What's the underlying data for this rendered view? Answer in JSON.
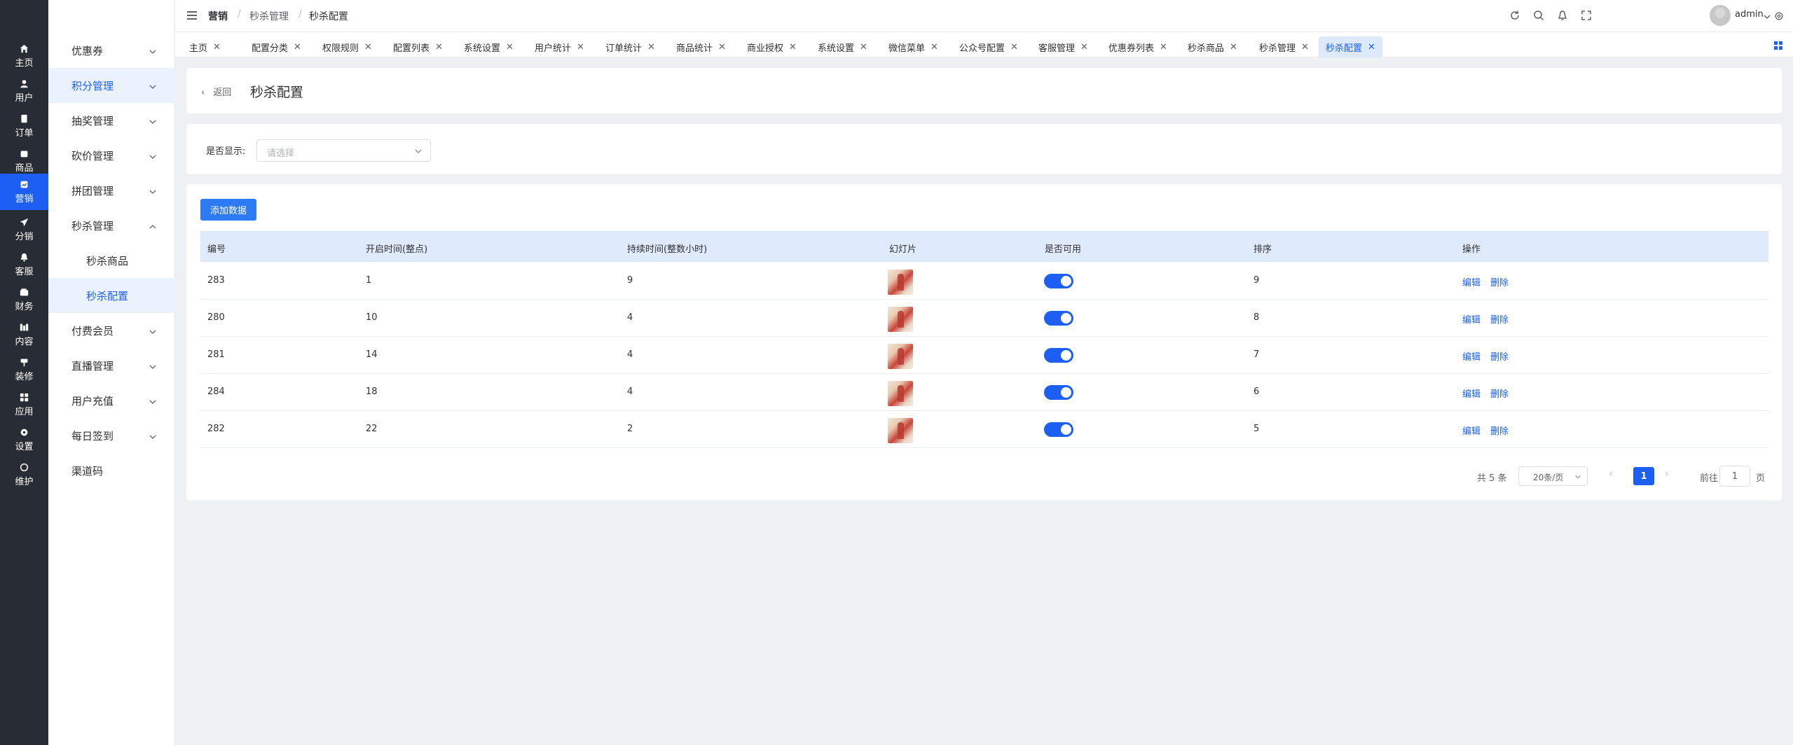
{
  "rail": [
    {
      "label": "主页",
      "icon": "home-icon"
    },
    {
      "label": "用户",
      "icon": "user-icon"
    },
    {
      "label": "订单",
      "icon": "order-icon"
    },
    {
      "label": "商品",
      "icon": "goods-icon"
    },
    {
      "label": "营销",
      "icon": "marketing-icon",
      "active": true
    },
    {
      "label": "分销",
      "icon": "send-icon"
    },
    {
      "label": "客服",
      "icon": "bell-icon"
    },
    {
      "label": "财务",
      "icon": "wallet-icon"
    },
    {
      "label": "内容",
      "icon": "content-icon"
    },
    {
      "label": "装修",
      "icon": "brush-icon"
    },
    {
      "label": "应用",
      "icon": "apps-icon"
    },
    {
      "label": "设置",
      "icon": "gear-icon"
    },
    {
      "label": "维护",
      "icon": "maintain-icon"
    }
  ],
  "menu": {
    "items": [
      {
        "label": "优惠券",
        "chevron": "down"
      },
      {
        "label": "积分管理",
        "chevron": "down",
        "active": true
      },
      {
        "label": "抽奖管理",
        "chevron": "down"
      },
      {
        "label": "砍价管理",
        "chevron": "down"
      },
      {
        "label": "拼团管理",
        "chevron": "down"
      },
      {
        "label": "秒杀管理",
        "chevron": "up"
      },
      {
        "label": "秒杀商品",
        "sub": true
      },
      {
        "label": "秒杀配置",
        "sub": true,
        "active": true
      },
      {
        "label": "付费会员",
        "chevron": "down"
      },
      {
        "label": "直播管理",
        "chevron": "down"
      },
      {
        "label": "用户充值",
        "chevron": "down"
      },
      {
        "label": "每日签到",
        "chevron": "down"
      },
      {
        "label": "渠道码"
      }
    ]
  },
  "header": {
    "breadcrumb": [
      "营销",
      "秒杀管理",
      "秒杀配置"
    ],
    "separator": "/",
    "user": "admin"
  },
  "tabs": [
    {
      "label": "主页"
    },
    {
      "label": "配置分类"
    },
    {
      "label": "权限规则"
    },
    {
      "label": "配置列表"
    },
    {
      "label": "系统设置"
    },
    {
      "label": "用户统计"
    },
    {
      "label": "订单统计"
    },
    {
      "label": "商品统计"
    },
    {
      "label": "商业授权"
    },
    {
      "label": "系统设置"
    },
    {
      "label": "微信菜单"
    },
    {
      "label": "公众号配置"
    },
    {
      "label": "客服管理"
    },
    {
      "label": "优惠券列表"
    },
    {
      "label": "秒杀商品"
    },
    {
      "label": "秒杀管理"
    },
    {
      "label": "秒杀配置",
      "active": true
    }
  ],
  "page": {
    "back_label": "返回",
    "title": "秒杀配置",
    "filter_label": "是否显示:",
    "filter_placeholder": "请选择",
    "add_button": "添加数据"
  },
  "table": {
    "columns": [
      "编号",
      "开启时间(整点)",
      "持续时间(整数小时)",
      "幻灯片",
      "是否可用",
      "排序",
      "操作"
    ],
    "rows": [
      {
        "id": "283",
        "start": "1",
        "duration": "9",
        "enabled": true,
        "sort": "9"
      },
      {
        "id": "280",
        "start": "10",
        "duration": "4",
        "enabled": true,
        "sort": "8"
      },
      {
        "id": "281",
        "start": "14",
        "duration": "4",
        "enabled": true,
        "sort": "7"
      },
      {
        "id": "284",
        "start": "18",
        "duration": "4",
        "enabled": true,
        "sort": "6"
      },
      {
        "id": "282",
        "start": "22",
        "duration": "2",
        "enabled": true,
        "sort": "5"
      }
    ],
    "edit_label": "编辑",
    "delete_label": "删除"
  },
  "pagination": {
    "total": "共 5 条",
    "page_size": "20条/页",
    "current": "1",
    "goto_label": "前往",
    "goto_value": "1",
    "page_suffix": "页"
  },
  "colors": {
    "accent": "#1c5ff2",
    "rail_bg": "#282c34",
    "header_row": "#dfeafc"
  }
}
